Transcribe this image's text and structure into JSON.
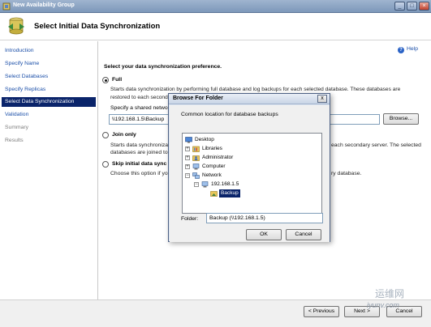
{
  "window": {
    "title": "New Availability Group",
    "buttons": [
      "minimize",
      "maximize",
      "close"
    ]
  },
  "header": {
    "title": "Select Initial Data Synchronization"
  },
  "sidebar": {
    "items": [
      {
        "label": "Introduction",
        "state": "link"
      },
      {
        "label": "Specify Name",
        "state": "link"
      },
      {
        "label": "Select Databases",
        "state": "link"
      },
      {
        "label": "Specify Replicas",
        "state": "link"
      },
      {
        "label": "Select Data Synchronization",
        "state": "selected"
      },
      {
        "label": "Validation",
        "state": "link"
      },
      {
        "label": "Summary",
        "state": "disabled"
      },
      {
        "label": "Results",
        "state": "disabled"
      }
    ]
  },
  "main": {
    "help": "Help",
    "prompt": "Select your data synchronization preference.",
    "full": {
      "label": "Full",
      "desc1": "Starts data synchronization by performing full database and log backups for each selected database. These databases are",
      "desc2": "restored to each second",
      "share_label": "Specify a shared network",
      "share_value": "\\\\192.168.1.5\\Backup",
      "browse": "Browse..."
    },
    "join": {
      "label": "Join only",
      "desc1": "Starts data synchronization",
      "desc1_right": "each secondary server. The selected",
      "desc2": "databases are joined to t"
    },
    "skip": {
      "label": "Skip initial data sync",
      "desc1": "Choose this option if yo",
      "desc1_right": "ry database."
    }
  },
  "footer": {
    "previous": "< Previous",
    "next": "Next >",
    "cancel": "Cancel"
  },
  "dialog": {
    "title": "Browse For Folder",
    "close": "x",
    "description": "Common location for database backups",
    "tree": [
      {
        "label": "Desktop",
        "icon": "desktop-icon"
      },
      {
        "label": "Libraries",
        "icon": "libraries-icon"
      },
      {
        "label": "Administrator",
        "icon": "user-folder-icon"
      },
      {
        "label": "Computer",
        "icon": "computer-icon"
      },
      {
        "label": "Network",
        "icon": "network-icon"
      },
      {
        "label": "192.168.1.5",
        "icon": "network-computer-icon"
      },
      {
        "label": "Backup",
        "icon": "shared-folder-icon"
      }
    ],
    "folder_label": "Folder:",
    "folder_value": "Backup (\\\\192.168.1.5)",
    "ok": "OK",
    "cancel": "Cancel"
  },
  "watermark": {
    "cn": "运维网",
    "url": "iyunv.com"
  },
  "colors": {
    "selected_nav": "#0a246a",
    "link": "#1a4ea8",
    "titlebar": "#7d98ba",
    "dialog_frame": "#dfe7f2"
  }
}
